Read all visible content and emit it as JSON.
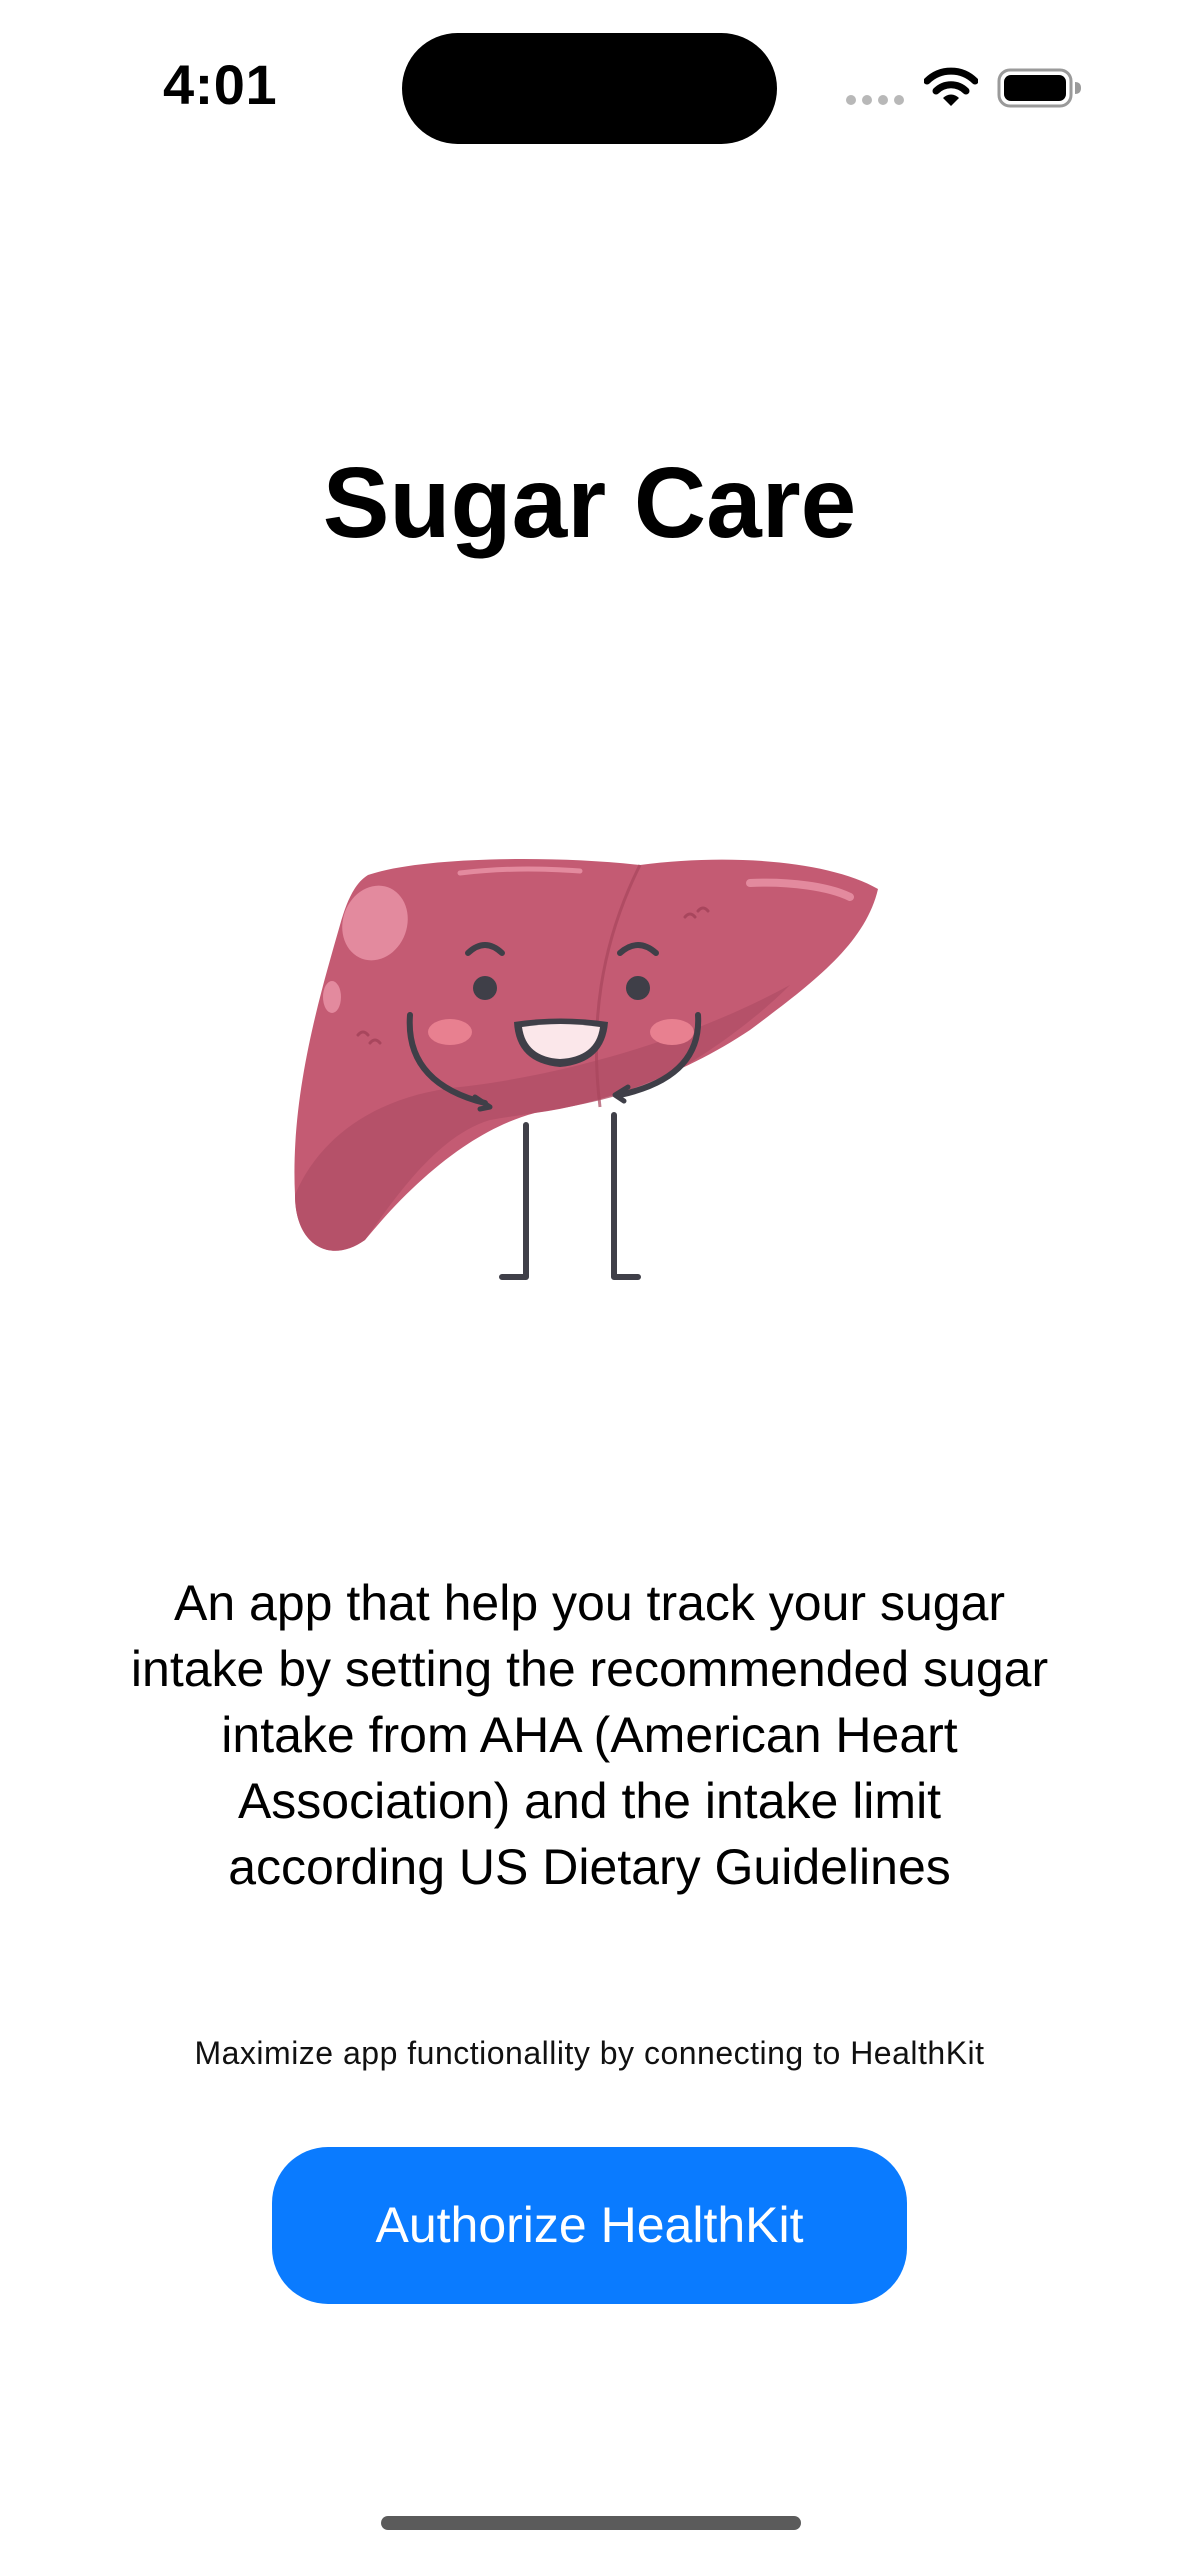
{
  "status_bar": {
    "time": "4:01",
    "icons": [
      "signal-dots-icon",
      "wifi-icon",
      "battery-icon"
    ]
  },
  "app": {
    "title": "Sugar Care",
    "mascot": "liver-mascot-icon",
    "description": "An app that help you track your sugar intake by setting the recommended sugar intake from AHA (American Heart Association) and the intake limit according US Dietary Guidelines",
    "hint": "Maximize app functionallity by connecting to HealthKit",
    "authorize_label": "Authorize HealthKit"
  },
  "colors": {
    "accent": "#0a7bff",
    "liver": "#c45b73",
    "background": "#ffffff"
  }
}
